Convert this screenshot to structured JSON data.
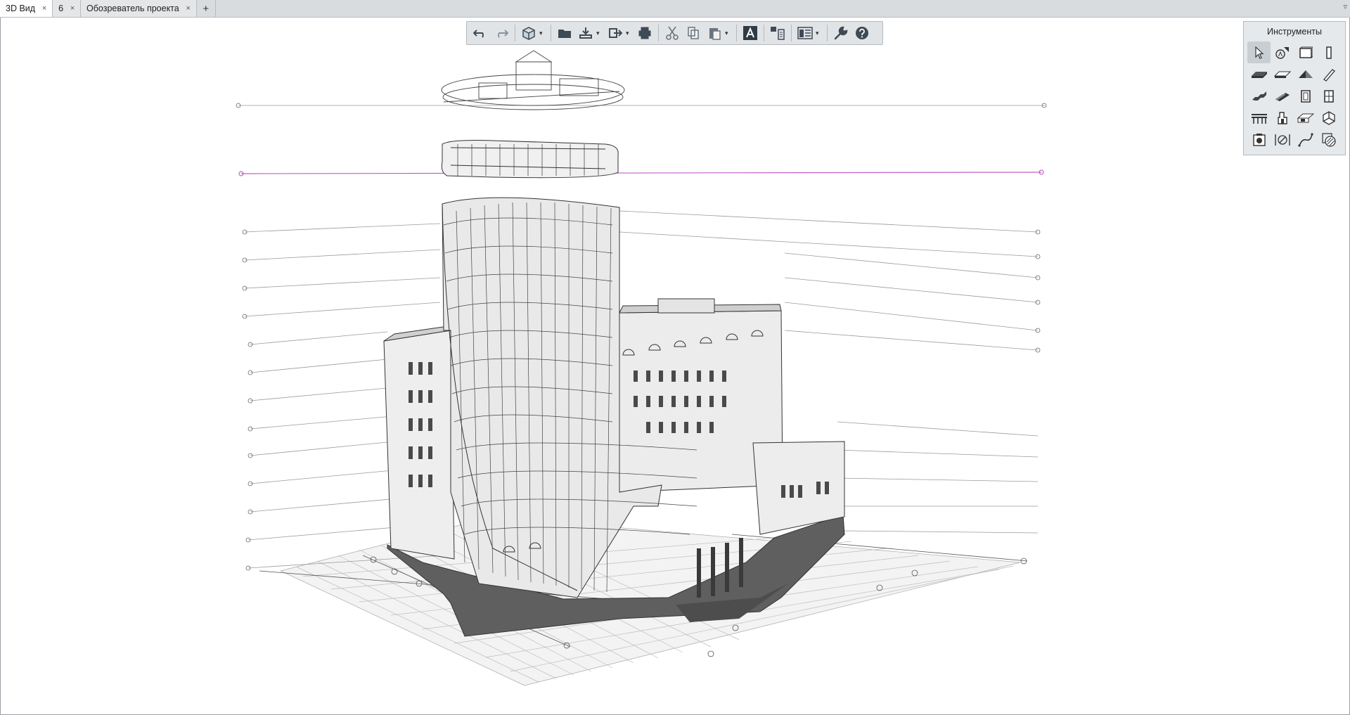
{
  "tabs": [
    {
      "label": "3D Вид",
      "active": true
    },
    {
      "label": "6",
      "active": false
    },
    {
      "label": "Обозреватель проекта",
      "active": false
    }
  ],
  "tab_close_glyph": "×",
  "tab_add_glyph": "+",
  "tab_menu_glyph": "▿",
  "toolbar": {
    "buttons": [
      "undo-icon",
      "redo-icon",
      "3d-view-icon",
      "open-icon",
      "save-icon",
      "export-icon",
      "print-icon",
      "cut-icon",
      "copy-icon",
      "paste-icon",
      "text-style-icon",
      "properties-icon",
      "layout-icon",
      "settings-wrench-icon",
      "help-icon"
    ],
    "dropdown_glyph": "▾"
  },
  "tools_panel": {
    "title": "Инструменты",
    "tools": [
      "select-arrow-icon",
      "annotate-icon",
      "wall-icon",
      "column-icon",
      "slab-icon",
      "floor-icon",
      "roof-icon",
      "beam-icon",
      "stair-icon",
      "ramp-icon",
      "door-icon",
      "window-icon",
      "railing-icon",
      "object-icon",
      "opening-icon",
      "shell-icon",
      "section-icon",
      "dimension-icon",
      "line-icon",
      "hatch-icon"
    ]
  },
  "colors": {
    "accent_level": "#c060c8",
    "tabbar": "#d9dcdf",
    "panel": "#e6e9ec"
  }
}
